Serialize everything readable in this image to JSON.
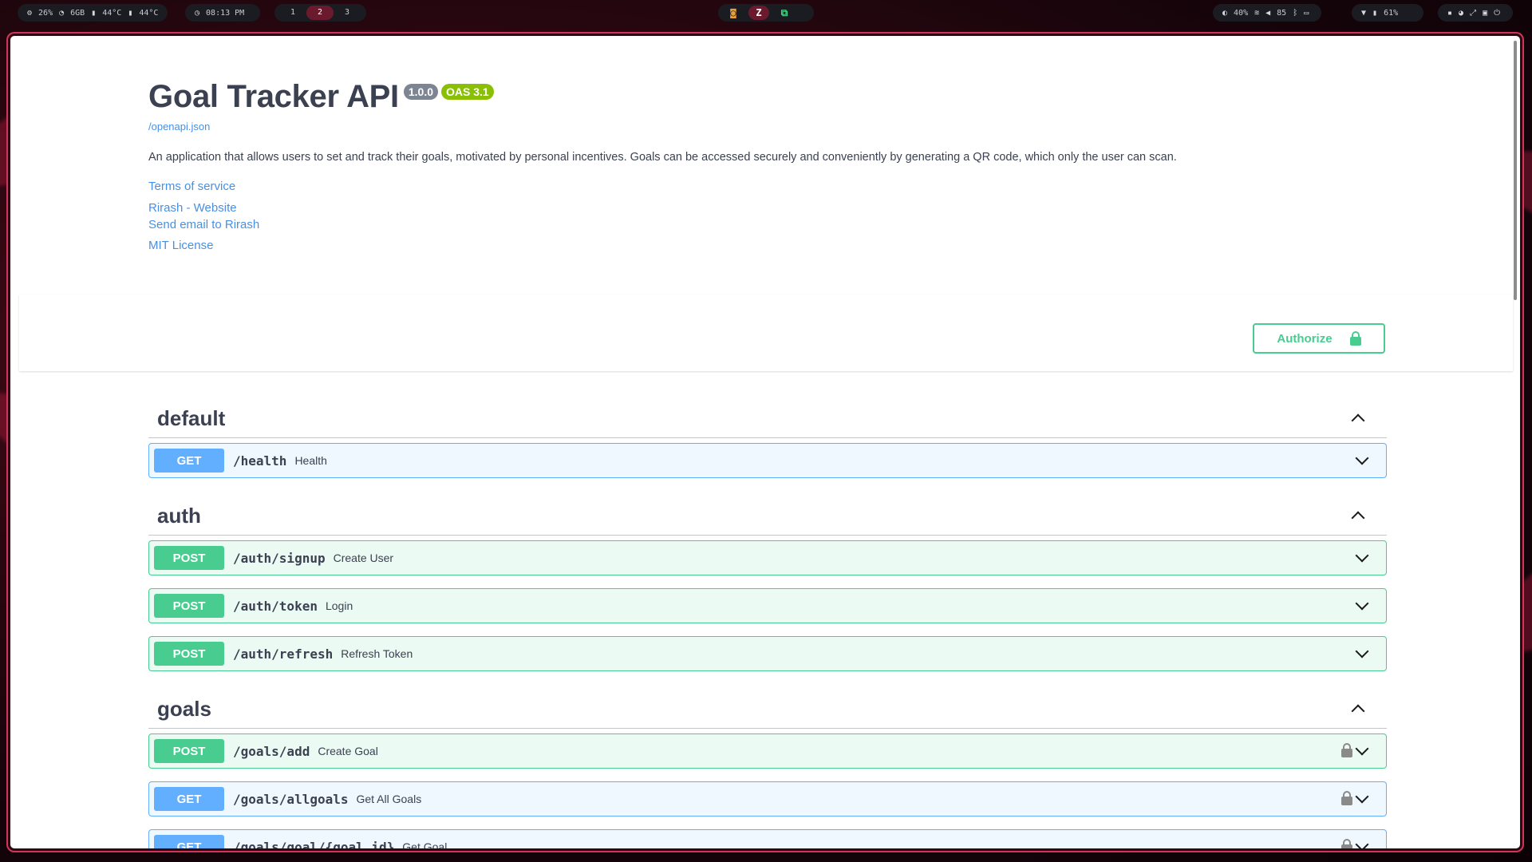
{
  "topbar": {
    "stats": [
      "26%",
      "6GB",
      "44°C",
      "44°C"
    ],
    "clock": "08:13 PM",
    "workspaces": [
      "1",
      "2",
      "3"
    ],
    "active_workspace": "2",
    "apps": [
      "browser-icon",
      "zed-icon",
      "terminal-icon"
    ],
    "system": [
      "40%",
      "85",
      "61%"
    ],
    "accent": "#6b1a2d"
  },
  "info": {
    "title": "Goal Tracker API",
    "version": "1.0.0",
    "oas": "OAS 3.1",
    "spec_url": "/openapi.json",
    "description": "An application that allows users to set and track their goals, motivated by personal incentives. Goals can be accessed securely and conveniently by generating a QR code, which only the user can scan.",
    "links": {
      "terms": "Terms of service",
      "website": "Rirash - Website",
      "email": "Send email to Rirash",
      "license": "MIT License"
    }
  },
  "authorize": {
    "label": "Authorize"
  },
  "colors": {
    "get": "#61affe",
    "post": "#49cc90",
    "link": "#4990e2",
    "text": "#3b4151"
  },
  "tags": [
    {
      "name": "default",
      "operations": [
        {
          "method": "GET",
          "path": "/health",
          "summary": "Health",
          "locked": false
        }
      ]
    },
    {
      "name": "auth",
      "operations": [
        {
          "method": "POST",
          "path": "/auth/signup",
          "summary": "Create User",
          "locked": false
        },
        {
          "method": "POST",
          "path": "/auth/token",
          "summary": "Login",
          "locked": false
        },
        {
          "method": "POST",
          "path": "/auth/refresh",
          "summary": "Refresh Token",
          "locked": false
        }
      ]
    },
    {
      "name": "goals",
      "operations": [
        {
          "method": "POST",
          "path": "/goals/add",
          "summary": "Create Goal",
          "locked": true
        },
        {
          "method": "GET",
          "path": "/goals/allgoals",
          "summary": "Get All Goals",
          "locked": true
        },
        {
          "method": "GET",
          "path": "/goals/goal/{goal_id}",
          "summary": "Get Goal",
          "locked": true
        }
      ]
    }
  ]
}
